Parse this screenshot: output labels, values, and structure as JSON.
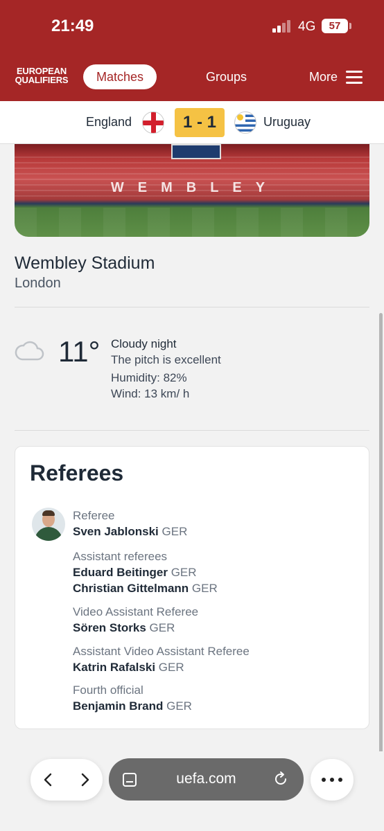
{
  "status_bar": {
    "time": "21:49",
    "network": "4G",
    "battery": "57"
  },
  "nav": {
    "logo_line1": "EUROPEAN",
    "logo_line2": "QUALIFIERS",
    "matches_label": "Matches",
    "groups_label": "Groups",
    "more_label": "More"
  },
  "match": {
    "home_team": "England",
    "score": "1 - 1",
    "away_team": "Uruguay"
  },
  "stadium_image": {
    "banner_text": "WEMBLEY"
  },
  "venue": {
    "name": "Wembley Stadium",
    "city": "London"
  },
  "weather": {
    "icon": "cloud-icon",
    "temperature": "11°",
    "condition": "Cloudy night",
    "pitch": "The pitch is excellent",
    "humidity": "Humidity: 82%",
    "wind": "Wind: 13 km/ h"
  },
  "referees": {
    "title": "Referees",
    "groups": [
      {
        "role": "Referee",
        "people": [
          {
            "name": "Sven Jablonski",
            "nat": "GER"
          }
        ]
      },
      {
        "role": "Assistant referees",
        "people": [
          {
            "name": "Eduard Beitinger",
            "nat": "GER"
          },
          {
            "name": "Christian Gittelmann",
            "nat": "GER"
          }
        ]
      },
      {
        "role": "Video Assistant Referee",
        "people": [
          {
            "name": "Sören Storks",
            "nat": "GER"
          }
        ]
      },
      {
        "role": "Assistant Video Assistant Referee",
        "people": [
          {
            "name": "Katrin Rafalski",
            "nat": "GER"
          }
        ]
      },
      {
        "role": "Fourth official",
        "people": [
          {
            "name": "Benjamin Brand",
            "nat": "GER"
          }
        ]
      }
    ]
  },
  "browser": {
    "url": "uefa.com"
  },
  "colors": {
    "brand": "#a52626",
    "score_bg": "#f5c244"
  }
}
